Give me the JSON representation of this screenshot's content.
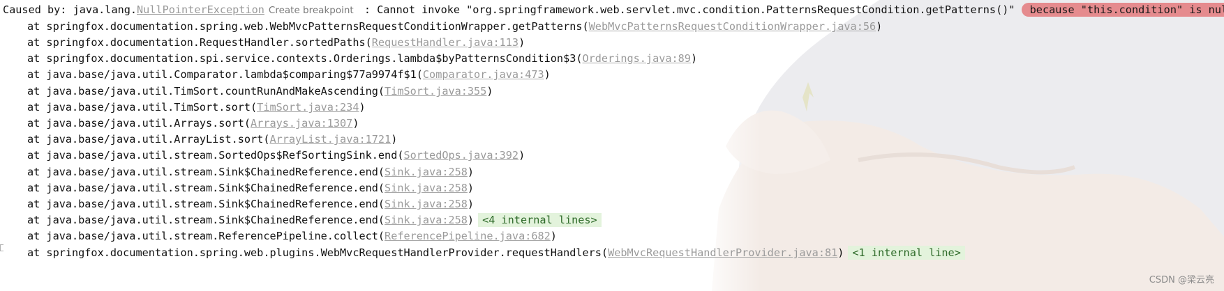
{
  "header": {
    "prefix": "Caused by: java.lang.",
    "exception_class": "NullPointerException",
    "breakpoint_hint": "Create breakpoint",
    "message": " : Cannot invoke \"org.springframework.web.servlet.mvc.condition.PatternsRequestCondition.getPatterns()\" ",
    "reason": "because \"this.condition\" is null"
  },
  "frames": [
    {
      "method": "at springfox.documentation.spring.web.WebMvcPatternsRequestConditionWrapper.getPatterns(",
      "source": "WebMvcPatternsRequestConditionWrapper.java:56",
      "suffix": ")",
      "folded": ""
    },
    {
      "method": "at springfox.documentation.RequestHandler.sortedPaths(",
      "source": "RequestHandler.java:113",
      "suffix": ")",
      "folded": ""
    },
    {
      "method": "at springfox.documentation.spi.service.contexts.Orderings.lambda$byPatternsCondition$3(",
      "source": "Orderings.java:89",
      "suffix": ")",
      "folded": ""
    },
    {
      "method": "at java.base/java.util.Comparator.lambda$comparing$77a9974f$1(",
      "source": "Comparator.java:473",
      "suffix": ")",
      "folded": ""
    },
    {
      "method": "at java.base/java.util.TimSort.countRunAndMakeAscending(",
      "source": "TimSort.java:355",
      "suffix": ")",
      "folded": ""
    },
    {
      "method": "at java.base/java.util.TimSort.sort(",
      "source": "TimSort.java:234",
      "suffix": ")",
      "folded": ""
    },
    {
      "method": "at java.base/java.util.Arrays.sort(",
      "source": "Arrays.java:1307",
      "suffix": ")",
      "folded": ""
    },
    {
      "method": "at java.base/java.util.ArrayList.sort(",
      "source": "ArrayList.java:1721",
      "suffix": ")",
      "folded": ""
    },
    {
      "method": "at java.base/java.util.stream.SortedOps$RefSortingSink.end(",
      "source": "SortedOps.java:392",
      "suffix": ")",
      "folded": ""
    },
    {
      "method": "at java.base/java.util.stream.Sink$ChainedReference.end(",
      "source": "Sink.java:258",
      "suffix": ")",
      "folded": ""
    },
    {
      "method": "at java.base/java.util.stream.Sink$ChainedReference.end(",
      "source": "Sink.java:258",
      "suffix": ")",
      "folded": ""
    },
    {
      "method": "at java.base/java.util.stream.Sink$ChainedReference.end(",
      "source": "Sink.java:258",
      "suffix": ")",
      "folded": ""
    },
    {
      "method": "at java.base/java.util.stream.Sink$ChainedReference.end(",
      "source": "Sink.java:258",
      "suffix": ")",
      "folded": "<4 internal lines>"
    },
    {
      "method": "at java.base/java.util.stream.ReferencePipeline.collect(",
      "source": "ReferencePipeline.java:682",
      "suffix": ")",
      "folded": ""
    },
    {
      "method": "at springfox.documentation.spring.web.plugins.WebMvcRequestHandlerProvider.requestHandlers(",
      "source": "WebMvcRequestHandlerProvider.java:81",
      "suffix": ")",
      "folded": "<1 internal line>"
    }
  ],
  "watermark": "CSDN @梁云亮",
  "colors": {
    "reason_bg": "#e58b8e",
    "folded_bg": "#e3f3dc",
    "link": "#9a9a9a"
  }
}
